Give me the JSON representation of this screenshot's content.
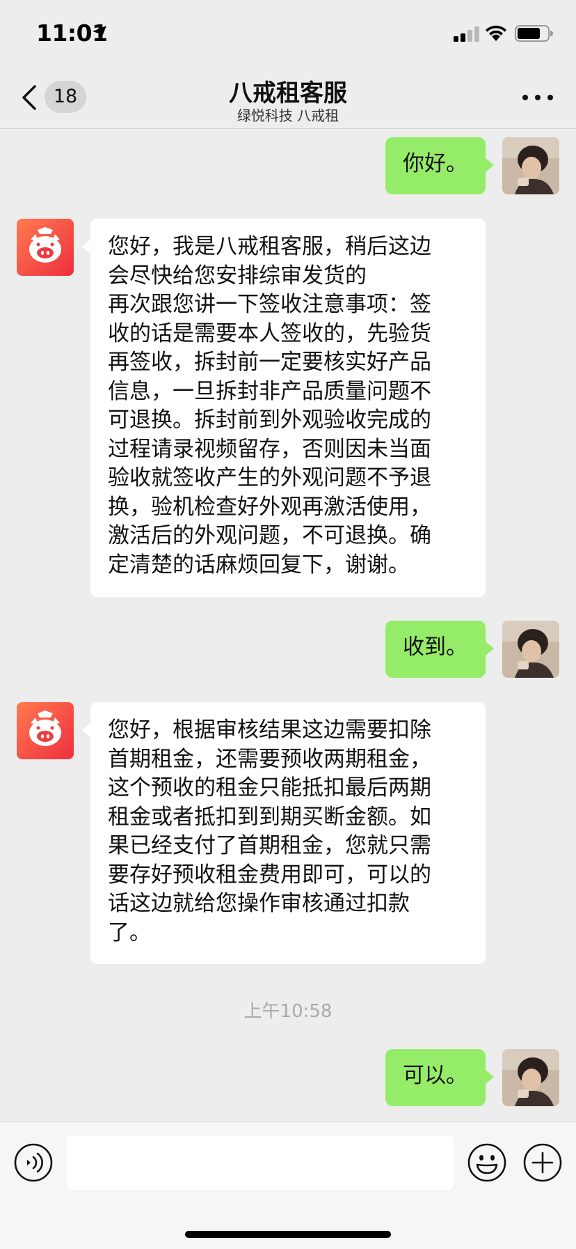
{
  "status_bar": {
    "time": "11:01",
    "icons": [
      "location-arrow-icon",
      "signal-icon",
      "wifi-icon",
      "battery-icon"
    ]
  },
  "header": {
    "back_icon": "chevron-left-icon",
    "unread_count": "18",
    "title": "八戒租客服",
    "subtitle": "绿悦科技 八戒租",
    "more_icon": "more-dots-icon"
  },
  "colors": {
    "background": "#ededed",
    "sent_bubble": "#95ec69",
    "received_bubble": "#ffffff",
    "brand_red": "#f04a3a",
    "timestamp_text": "#a9a9a9"
  },
  "messages": [
    {
      "side": "right",
      "sender": "user",
      "text": "你好。"
    },
    {
      "side": "left",
      "sender": "八戒租客服",
      "text": "您好，我是八戒租客服，稍后这边\n会尽快给您安排综审发货的\n再次跟您讲一下签收注意事项：签\n收的话是需要本人签收的，先验货\n再签收，拆封前一定要核实好产品\n信息，一旦拆封非产品质量问题不\n可退换。拆封前到外观验收完成的\n过程请录视频留存，否则因未当面\n验收就签收产生的外观问题不予退\n换，验机检查好外观再激活使用，\n激活后的外观问题，不可退换。确\n定清楚的话麻烦回复下，谢谢。"
    },
    {
      "side": "right",
      "sender": "user",
      "text": "收到。"
    },
    {
      "side": "left",
      "sender": "八戒租客服",
      "text": "您好，根据审核结果这边需要扣除\n首期租金，还需要预收两期租金，\n这个预收的租金只能抵扣最后两期\n租金或者抵扣到到期买断金额。如\n果已经支付了首期租金，您就只需\n要存好预收租金费用即可，可以的\n话这边就给您操作审核通过扣款\n了。"
    },
    {
      "side": "right",
      "sender": "user",
      "text": "可以。"
    }
  ],
  "timestamp": "上午10:58",
  "input_bar": {
    "voice_icon": "voice-icon",
    "input_value": "",
    "emoji_icon": "emoji-icon",
    "plus_icon": "plus-icon"
  }
}
